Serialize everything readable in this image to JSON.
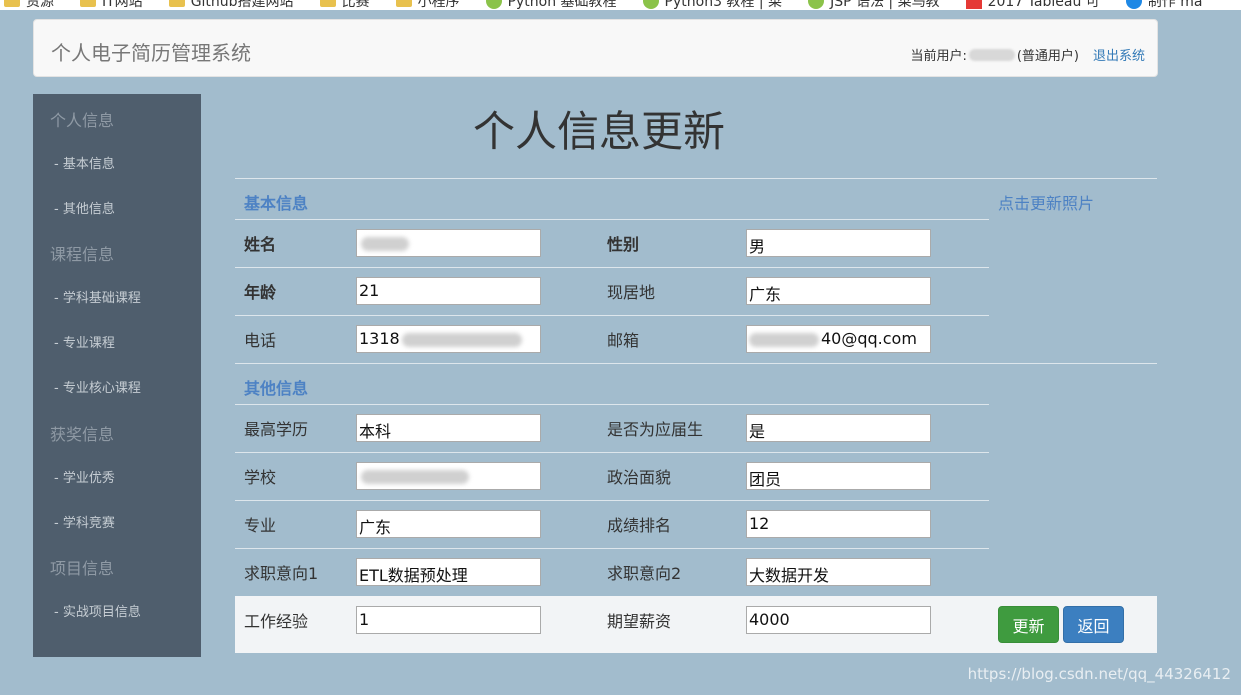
{
  "bookmarks": [
    "资源",
    "IT网站",
    "Github搭建网站",
    "比赛",
    "小程序",
    "Python 基础教程",
    "Python3 教程 | 菜",
    "JSP 语法 | 菜鸟教",
    "2017 Tableau 可",
    "制作 ma"
  ],
  "header": {
    "title": "个人电子简历管理系统",
    "user_prefix": "当前用户:",
    "user_suffix": "(普通用户)",
    "logout": "退出系统"
  },
  "sidebar": {
    "sections": [
      {
        "title": "个人信息",
        "items": [
          "- 基本信息",
          "- 其他信息"
        ]
      },
      {
        "title": "课程信息",
        "items": [
          "- 学科基础课程",
          "- 专业课程",
          "- 专业核心课程"
        ]
      },
      {
        "title": "获奖信息",
        "items": [
          "- 学业优秀",
          "- 学科竞赛"
        ]
      },
      {
        "title": "项目信息",
        "items": [
          "- 实战项目信息"
        ]
      }
    ]
  },
  "page": {
    "title": "个人信息更新",
    "basic_title": "基本信息",
    "photo_link": "点击更新照片",
    "other_title": "其他信息"
  },
  "form": {
    "name_label": "姓名",
    "name_value": "",
    "gender_label": "性别",
    "gender_value": "男",
    "age_label": "年龄",
    "age_value": "21",
    "location_label": "现居地",
    "location_value": "广东",
    "phone_label": "电话",
    "phone_value": "1318",
    "email_label": "邮箱",
    "email_value": "40@qq.com",
    "degree_label": "最高学历",
    "degree_value": "本科",
    "fresh_label": "是否为应届生",
    "fresh_value": "是",
    "school_label": "学校",
    "school_value": "",
    "politics_label": "政治面貌",
    "politics_value": "团员",
    "major_label": "专业",
    "major_value": "广东",
    "rank_label": "成绩排名",
    "rank_value": "12",
    "job1_label": "求职意向1",
    "job1_value": "ETL数据预处理",
    "job2_label": "求职意向2",
    "job2_value": "大数据开发",
    "exp_label": "工作经验",
    "exp_value": "1",
    "salary_label": "期望薪资",
    "salary_value": "4000"
  },
  "buttons": {
    "update": "更新",
    "back": "返回"
  },
  "watermark": "https://blog.csdn.net/qq_44326412"
}
